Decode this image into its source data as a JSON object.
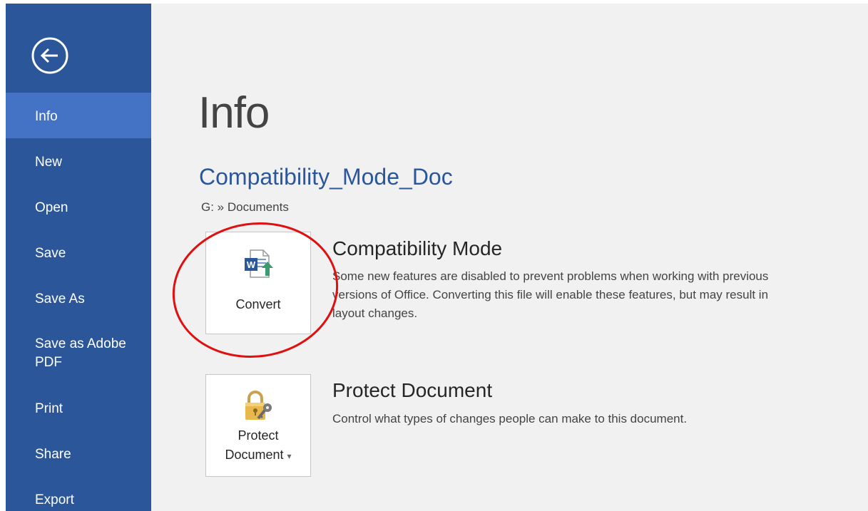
{
  "sidebar": {
    "back_label": "Back",
    "items": [
      {
        "label": "Info",
        "active": true
      },
      {
        "label": "New"
      },
      {
        "label": "Open"
      },
      {
        "label": "Save"
      },
      {
        "label": "Save As"
      },
      {
        "label_line1": "Save as Adobe",
        "label_line2": "PDF"
      },
      {
        "label": "Print"
      },
      {
        "label": "Share"
      },
      {
        "label": "Export"
      }
    ]
  },
  "main": {
    "title": "Info",
    "doc_name": "Compatibility_Mode_Doc",
    "doc_path": "G: » Documents",
    "compatibility": {
      "button_label": "Convert",
      "heading": "Compatibility Mode",
      "description_lines": [
        "Some new features are disabled to prevent problems when working with previous",
        "versions of Office. Converting this file will enable these features, but may result in",
        "layout changes."
      ]
    },
    "protect": {
      "button_line1": "Protect",
      "button_line2": "Document",
      "dropdown_glyph": "▾",
      "heading": "Protect Document",
      "description": "Control what types of changes people can make to this document."
    }
  },
  "colors": {
    "sidebar": "#2b579a",
    "sidebar_active": "#4472c4",
    "accent_blue": "#2b579a",
    "annotation_red": "#e01010",
    "background": "#f1f1f1"
  },
  "icons": {
    "back": "back-arrow-circle-icon",
    "convert": "word-convert-icon",
    "protect": "padlock-key-icon"
  }
}
